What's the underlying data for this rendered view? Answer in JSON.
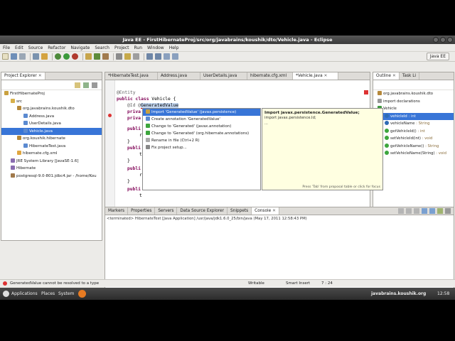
{
  "window": {
    "title": "Java EE - FirstHibernateProj/src/org/javabrains/koushik/dto/Vehicle.java - Eclipse"
  },
  "menu": [
    "File",
    "Edit",
    "Source",
    "Refactor",
    "Navigate",
    "Search",
    "Project",
    "Run",
    "Window",
    "Help"
  ],
  "toolbar": {
    "perspective": "Java EE"
  },
  "explorer": {
    "tab": "Project Explorer",
    "items": [
      {
        "label": "FirstHibernateProj",
        "indent": 0,
        "icon": "project-icon"
      },
      {
        "label": "src",
        "indent": 1,
        "icon": "folder-icon"
      },
      {
        "label": "org.javabrains.koushik.dto",
        "indent": 2,
        "icon": "package-icon"
      },
      {
        "label": "Address.java",
        "indent": 3,
        "icon": "java-file-icon"
      },
      {
        "label": "UserDetails.java",
        "indent": 3,
        "icon": "java-file-icon"
      },
      {
        "label": "Vehicle.java",
        "indent": 3,
        "icon": "java-file-icon",
        "selected": true
      },
      {
        "label": "org.koushik.hibernate",
        "indent": 2,
        "icon": "package-icon"
      },
      {
        "label": "HibernateTest.java",
        "indent": 3,
        "icon": "java-file-icon"
      },
      {
        "label": "hibernate.cfg.xml",
        "indent": 2,
        "icon": "xml-file-icon"
      },
      {
        "label": "JRE System Library [JavaSE-1.6]",
        "indent": 1,
        "icon": "library-icon"
      },
      {
        "label": "Hibernate",
        "indent": 1,
        "icon": "library-icon"
      },
      {
        "label": "postgresql-9.0-801.jdbc4.jar - /home/Kou",
        "indent": 1,
        "icon": "jar-icon"
      }
    ]
  },
  "editor": {
    "tabs": [
      "*HibernateTest.java",
      "Address.java",
      "UserDetails.java",
      "hibernate.cfg.xml",
      "*Vehicle.java"
    ],
    "active_tab": 4,
    "lines": {
      "l1": "@Entity",
      "l2_kw": "public class",
      "l2_rest": " Vehicle {",
      "l3_ann": "@Id @",
      "l3_hl": "GeneratedValue",
      "l4": "priva",
      "l5": "priva",
      "l6": "publi",
      "l7": "r",
      "l8": "}",
      "l9": "publi",
      "l10": "t",
      "l11": "}",
      "l12": "publi",
      "l13": "r",
      "l14": "}",
      "l15": "publi",
      "l16": "t"
    }
  },
  "assist": {
    "items": [
      "Import 'GeneratedValue' (javax.persistence)",
      "Create annotation 'GeneratedValue'",
      "Change to 'Generated' (javax.annotation)",
      "Change to 'Generated' (org.hibernate.annotations)",
      "Rename in file (Ctrl+2 R)",
      "Fix project setup..."
    ],
    "selected": 0,
    "doc_title": "Import javax.persistence.GeneratedValue;",
    "doc_lines": [
      "import javax.persistence.Id;",
      "..."
    ],
    "doc_footer": "Press 'Tab' from proposal table or click for focus"
  },
  "outline": {
    "tabs": [
      "Outline",
      "Task Li"
    ],
    "items": [
      {
        "name": "org.javabrains.koushik.dto",
        "type": "",
        "indent": 0,
        "icon": "package-icon"
      },
      {
        "name": "import declarations",
        "type": "",
        "indent": 0,
        "icon": "import-icon"
      },
      {
        "name": "Vehicle",
        "type": "",
        "indent": 0,
        "icon": "class-icon"
      },
      {
        "name": "vehicleId",
        "type": " : int",
        "indent": 1,
        "icon": "field-icon",
        "selected": true
      },
      {
        "name": "vehicleName",
        "type": " : String",
        "indent": 1,
        "icon": "field-icon"
      },
      {
        "name": "getVehicleId()",
        "type": " : int",
        "indent": 1,
        "icon": "method-icon"
      },
      {
        "name": "setVehicleId(int)",
        "type": " : void",
        "indent": 1,
        "icon": "method-icon"
      },
      {
        "name": "getVehicleName()",
        "type": " : String",
        "indent": 1,
        "icon": "method-icon"
      },
      {
        "name": "setVehicleName(String)",
        "type": " : void",
        "indent": 1,
        "icon": "method-icon"
      }
    ]
  },
  "bottom": {
    "tabs": [
      "Markers",
      "Properties",
      "Servers",
      "Data Source Explorer",
      "Snippets",
      "Console"
    ],
    "active_tab": 5,
    "console_text": "<terminated> HibernateTest [Java Application] /usr/java/jdk1.6.0_25/bin/java (May 17, 2011 12:58:43 PM)"
  },
  "status": {
    "message": "GeneratedValue cannot be resolved to a type",
    "writable": "Writable",
    "insert": "Smart Insert",
    "position": "7 : 24"
  },
  "panel": {
    "applications": "Applications",
    "places": "Places",
    "system": "System",
    "watermark": "javabrains.koushik.org",
    "clock": "12:58"
  },
  "colors": {
    "selection": "#3875d7",
    "keyword": "#7f0055",
    "doc_bg": "#ffffe1"
  }
}
